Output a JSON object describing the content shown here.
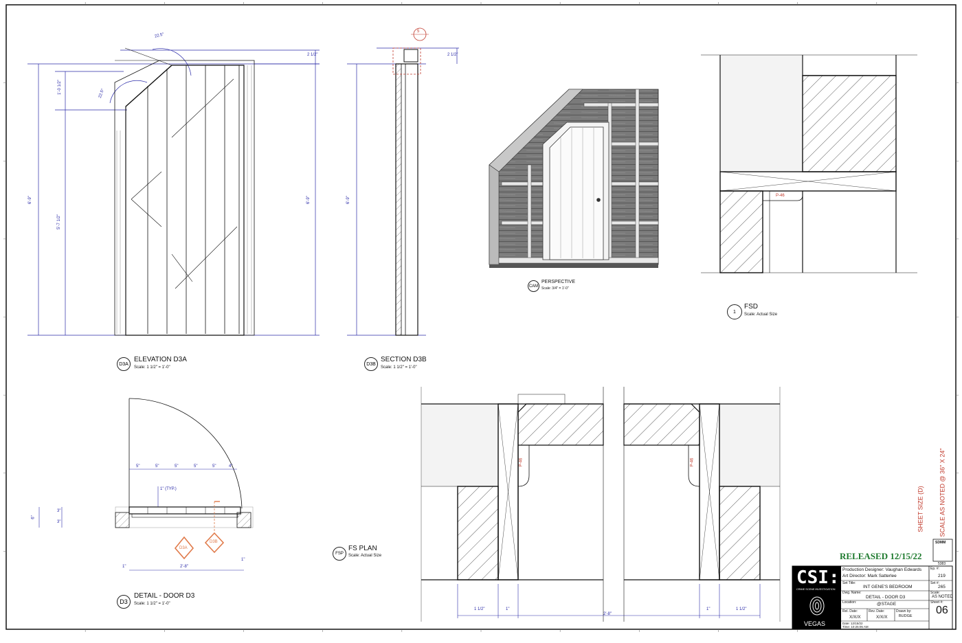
{
  "views": {
    "elevation": {
      "tag": "D3A",
      "title": "ELEVATION D3A",
      "scale": "Scale: 1 1/2\" = 1'-0\""
    },
    "section": {
      "tag": "D3B",
      "title": "SECTION D3B",
      "scale": "Scale: 1 1/2\" = 1'-0\""
    },
    "perspective": {
      "tag": "CAM",
      "title": "PERSPECTIVE",
      "scale": "Scale: 3/4\" = 1'-0\""
    },
    "fsd": {
      "tag": "1",
      "title": "FSD",
      "scale": "Scale: Actual Size"
    },
    "detail": {
      "tag": "D3",
      "title": "DETAIL - DOOR D3",
      "scale": "Scale: 1 1/2\" = 1'-0\""
    },
    "fsplan": {
      "tag": "FSP",
      "title": "FS PLAN",
      "scale": "Scale: Actual Size"
    }
  },
  "dimensions": {
    "angle": "22.5°",
    "ovr_height": "6'-9\"",
    "door_height": "5'-7 1/2\"",
    "top_offset": "1'-0 1/2\"",
    "head": "2 1/2\"",
    "width": "2'-8\"",
    "board": "5\"",
    "board_end": "4\"",
    "typ": "1\" (TYP.)",
    "paint": "P-46",
    "wall_a": "5\"",
    "wall_b": "3\"",
    "wall_c": "3\"",
    "wall_total": "6\"",
    "side": "1\"",
    "plan_a": "1 1/2\"",
    "plan_b": "1\""
  },
  "callouts": {
    "a": "D3A",
    "b": "D3B",
    "section_mark": "5"
  },
  "stamp": {
    "released": "RELEASED 12/15/22",
    "sheet_size": "SHEET SIZE (D)",
    "scale_note": "SCALE AS NOTED @ 36\" X 24\"",
    "union": "SDMM",
    "union_no": "5383"
  },
  "titleblock": {
    "logo": "CSI:",
    "logo_sub": "CRIME SCENE INVESTIGATION",
    "logo_city": "VEGAS",
    "designer": "Production Designer:  Vaughan Edwards",
    "art_director": "Art Director:  Mark Satterlee",
    "set_title_label": "Set Title:",
    "set_title": "INT GENE'S BEDROOM",
    "dwg_label": "Dwg. Name:",
    "dwg_name": "DETAIL - DOOR D3",
    "location_label": "Location:",
    "location": "@STAGE",
    "rel_label": "Rel. Date:",
    "rel_value": "X/X/X",
    "rev_label": "Rev. Date:",
    "rev_value": "X/X/X",
    "drawn_label": "Drawn by:",
    "drawn_value": "BUDGE",
    "date_line": "Date: 12/15/22",
    "time_line": "Time: 10:25:05 AM",
    "ep_label": "Ep. #:",
    "ep_value": "219",
    "set_label": "Set #:",
    "set_value": "265",
    "scale_label": "Scale:",
    "scale_value": "AS NOTED",
    "sheet_label": "Sheet #:",
    "sheet_value": "06"
  },
  "colors": {
    "line": "#111111",
    "dim": "#2a2aa8",
    "red": "#c0392b",
    "orange": "#e07a4a",
    "green": "#1e7a2e"
  }
}
